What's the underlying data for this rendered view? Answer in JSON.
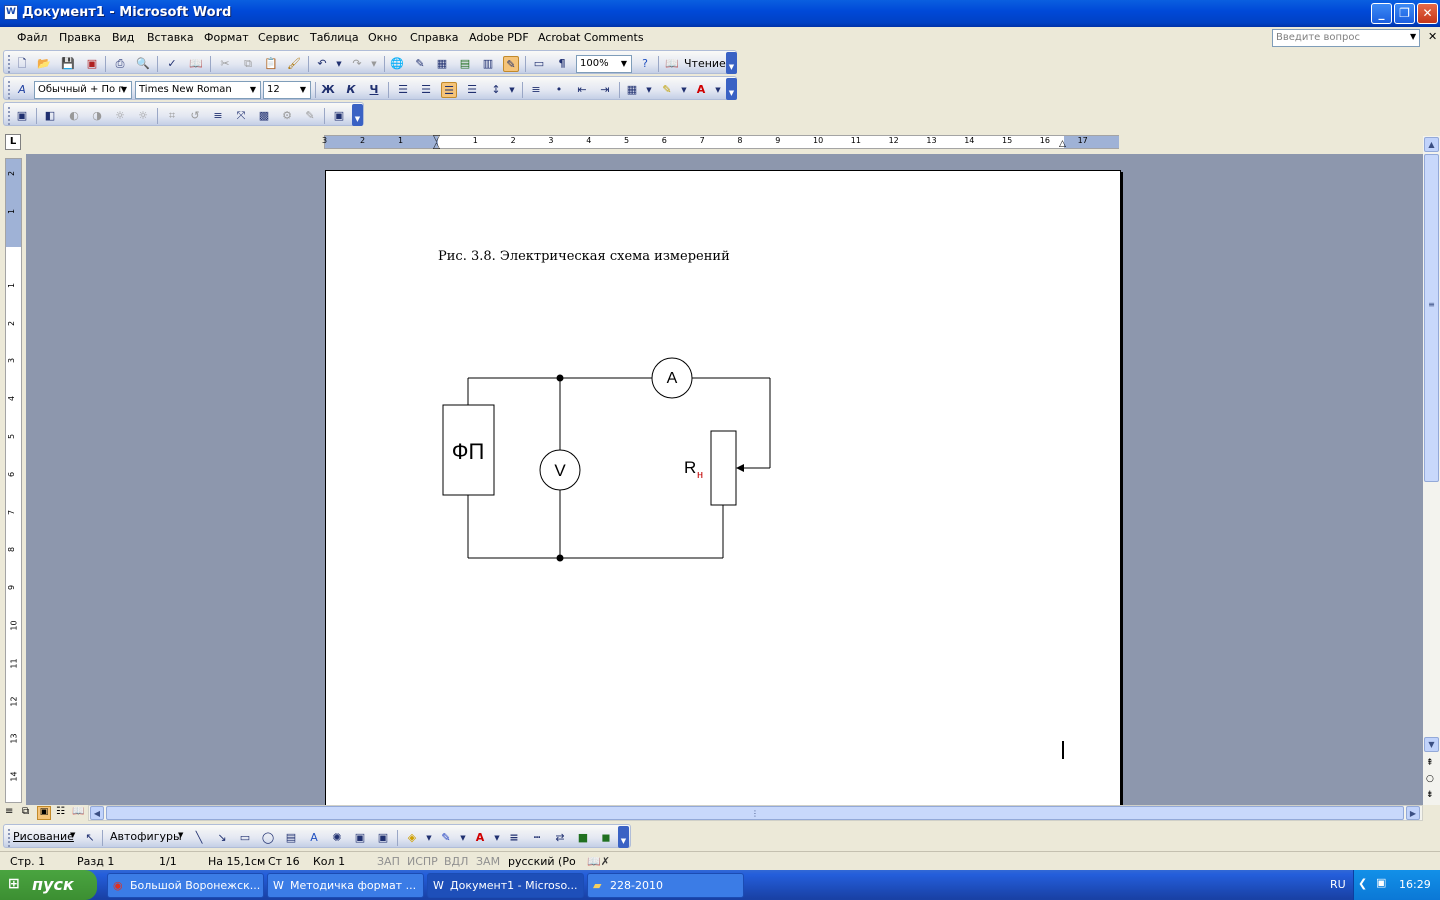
{
  "window": {
    "title": "Документ1 - Microsoft Word",
    "app_icon": "W"
  },
  "menu": {
    "items": [
      "Файл",
      "Правка",
      "Вид",
      "Вставка",
      "Формат",
      "Сервис",
      "Таблица",
      "Окно",
      "Справка",
      "Adobe PDF",
      "Acrobat Comments"
    ],
    "ask_placeholder": "Введите вопрос"
  },
  "standard_toolbar": {
    "zoom": "100%",
    "read_label": "Чтение"
  },
  "format_toolbar": {
    "style": "Обычный + По г",
    "font": "Times New Roman",
    "size": "12",
    "bold": "Ж",
    "italic": "К",
    "underline": "Ч",
    "pilcrow": "¶"
  },
  "ruler": {
    "h_labels": [
      "3",
      "2",
      "1",
      "1",
      "2",
      "3",
      "4",
      "5",
      "6",
      "7",
      "8",
      "9",
      "10",
      "11",
      "12",
      "13",
      "14",
      "15",
      "16",
      "17"
    ],
    "v_labels": [
      "2",
      "1",
      "1",
      "2",
      "3",
      "4",
      "5",
      "6",
      "7",
      "8",
      "9",
      "10",
      "11",
      "12",
      "13",
      "14"
    ],
    "tab_selector": "L"
  },
  "document": {
    "caption": "Рис. 3.8. Электрическая схема измерений",
    "circuit": {
      "source": "ФП",
      "ammeter": "А",
      "voltmeter": "V",
      "load": "R",
      "load_sub": "н"
    }
  },
  "drawing_toolbar": {
    "draw_label": "Рисование",
    "autoshapes_label": "Автофигуры"
  },
  "status": {
    "page": "Стр. 1",
    "section": "Разд 1",
    "pages": "1/1",
    "at": "На 15,1см",
    "line": "Ст 16",
    "col": "Кол 1",
    "rec": "ЗАП",
    "trk": "ИСПР",
    "ext": "ВДЛ",
    "ovr": "ЗАМ",
    "lang": "русский (Ро"
  },
  "taskbar": {
    "start": "пуск",
    "tasks": [
      "Большой Воронежск...",
      "Методичка формат ...",
      "Документ1 - Microso...",
      "228-2010"
    ],
    "lang": "RU",
    "clock": "16:29"
  },
  "colors": {
    "title_bar": "#0049d8",
    "doc_bg": "#8d97ad",
    "taskbar": "#245edb",
    "start": "#3c8f32"
  }
}
